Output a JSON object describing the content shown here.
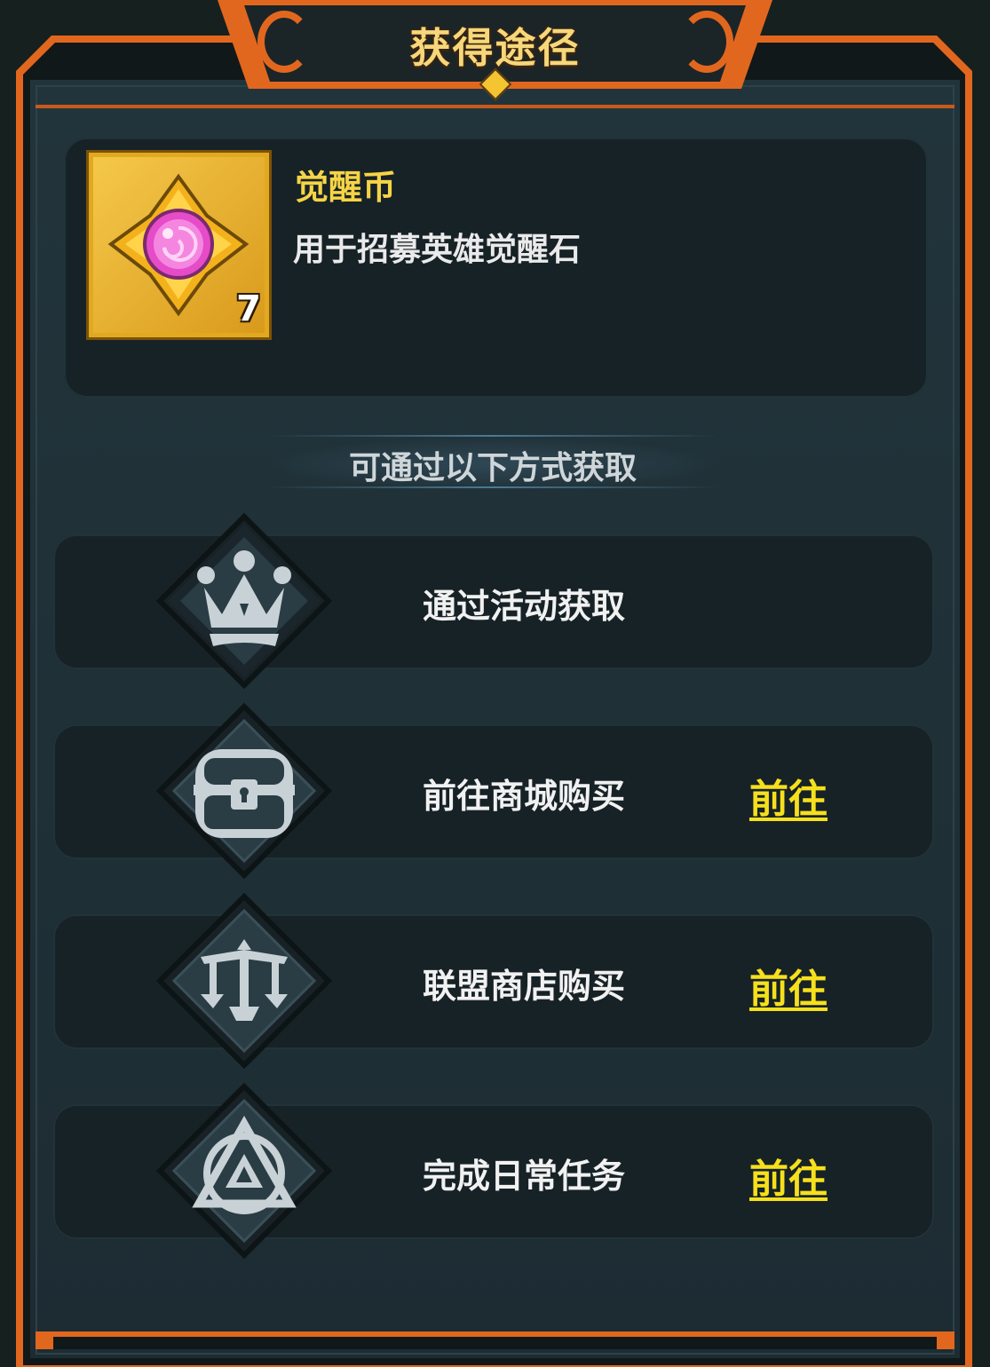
{
  "dialog": {
    "title": "获得途径"
  },
  "item": {
    "name": "觉醒币",
    "description": "用于招募英雄觉醒石",
    "count": "7",
    "icon": "pink-orb-star-icon"
  },
  "sources_heading": "可通过以下方式获取",
  "sources": [
    {
      "label": "通过活动获取",
      "icon": "crown-icon",
      "go_label": ""
    },
    {
      "label": "前往商城购买",
      "icon": "treasure-chest-icon",
      "go_label": "前往"
    },
    {
      "label": "联盟商店购买",
      "icon": "guild-scales-icon",
      "go_label": "前往"
    },
    {
      "label": "完成日常任务",
      "icon": "triangle-emblem-icon",
      "go_label": "前往"
    }
  ],
  "colors": {
    "accent_orange": "#e2671e",
    "title_gold": "#f6d77a",
    "item_name_yellow": "#f6d446",
    "go_link_yellow": "#f6e01c",
    "panel_bg": "#1d2c33"
  }
}
